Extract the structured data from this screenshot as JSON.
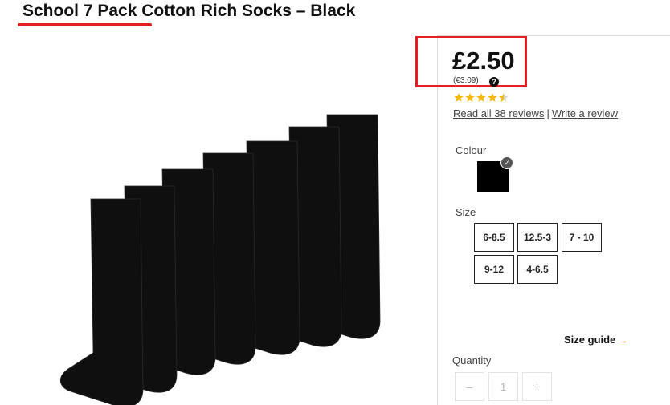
{
  "product": {
    "title": "School 7 Pack Cotton Rich Socks – Black",
    "image_icon": "black-socks-image"
  },
  "pricing": {
    "price": "£2.50",
    "price_eur": "(€3.09)",
    "help_icon": "?"
  },
  "rating": {
    "stars": 4.5,
    "max_stars": 5,
    "star_color": "#f5b800",
    "read_reviews": "Read all 38 reviews",
    "separator": "|",
    "write_review": "Write a review"
  },
  "colour": {
    "label": "Colour",
    "selected": "#000000",
    "check": "✓"
  },
  "size": {
    "label": "Size",
    "options": [
      "6-8.5",
      "12.5-3",
      "7 - 10",
      "9-12",
      "4-6.5"
    ]
  },
  "size_guide": {
    "label": "Size guide",
    "arrow": "→"
  },
  "quantity": {
    "label": "Quantity",
    "minus": "–",
    "value": "1",
    "plus": "+"
  },
  "colors": {
    "accent_red": "#e41e25",
    "size_guide_arrow": "#e8a200"
  }
}
